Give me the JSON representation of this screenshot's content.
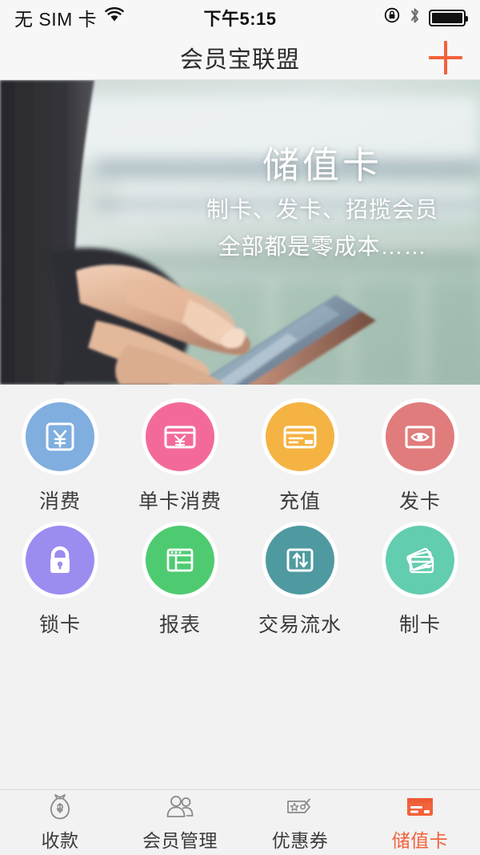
{
  "status_bar": {
    "carrier": "无 SIM 卡",
    "wifi_icon": "wifi-icon",
    "time": "下午5:15",
    "rotation_lock_icon": "rotation-lock-icon",
    "bluetooth_icon": "bluetooth-icon",
    "battery_icon": "battery-full-icon"
  },
  "nav": {
    "title": "会员宝联盟",
    "add_icon": "plus-icon"
  },
  "banner": {
    "title": "储值卡",
    "subtitle_line1": "制卡、发卡、招揽会员",
    "subtitle_line2": "全部都是零成本……",
    "image_description": "hand-touching-tablet-photo"
  },
  "grid": {
    "items": [
      {
        "label": "消费",
        "icon": "yen-in-square-icon",
        "color": "#7FAEDF"
      },
      {
        "label": "单卡消费",
        "icon": "card-yen-icon",
        "color": "#F36A9A"
      },
      {
        "label": "充值",
        "icon": "credit-card-icon",
        "color": "#F5B343"
      },
      {
        "label": "发卡",
        "icon": "eye-in-card-icon",
        "color": "#E07C7C"
      },
      {
        "label": "锁卡",
        "icon": "lock-icon",
        "color": "#9B8CF0"
      },
      {
        "label": "报表",
        "icon": "report-window-icon",
        "color": "#4ECB71"
      },
      {
        "label": "交易流水",
        "icon": "up-down-arrows-icon",
        "color": "#4F9AA0"
      },
      {
        "label": "制卡",
        "icon": "stacked-cards-icon",
        "color": "#63CDAF"
      }
    ]
  },
  "tabbar": {
    "active_color": "#F2623C",
    "items": [
      {
        "label": "收款",
        "icon": "money-bag-icon",
        "active": false
      },
      {
        "label": "会员管理",
        "icon": "people-icon",
        "active": false
      },
      {
        "label": "优惠券",
        "icon": "coupon-icon",
        "active": false
      },
      {
        "label": "储值卡",
        "icon": "card-icon",
        "active": true
      }
    ]
  }
}
